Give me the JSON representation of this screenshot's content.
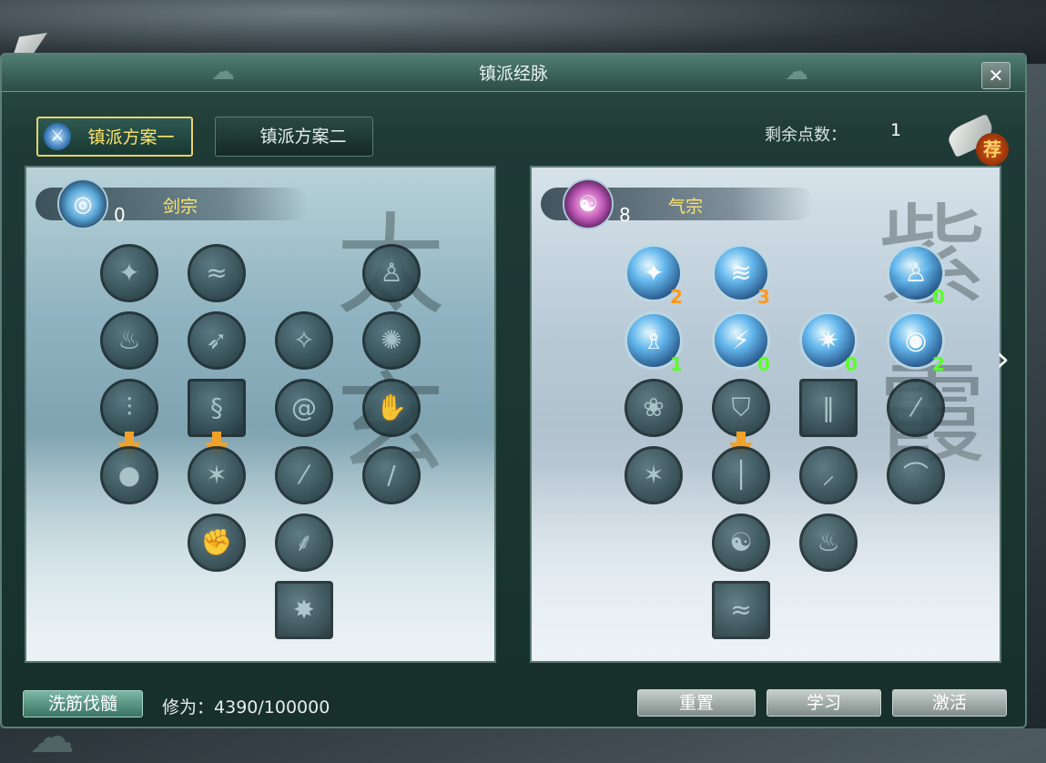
{
  "window": {
    "title": "镇派经脉",
    "close_label": "✕"
  },
  "tabs": [
    {
      "label": "镇派方案一",
      "active": true
    },
    {
      "label": "镇派方案二",
      "active": false
    }
  ],
  "points": {
    "label": "剩余点数：",
    "value": "1"
  },
  "recommend": {
    "badge": "荐"
  },
  "schools": [
    {
      "name": "剑宗",
      "count": "0",
      "deco_text": "太玄",
      "skills": [
        {
          "icon": "meditation-icon",
          "level": ""
        },
        {
          "icon": "sword-swirl-icon",
          "level": ""
        },
        {
          "icon": "warrior-icon",
          "level": ""
        },
        {
          "icon": "flame-icon",
          "level": ""
        },
        {
          "icon": "dash-icon",
          "level": ""
        },
        {
          "icon": "leap-icon",
          "level": ""
        },
        {
          "icon": "blade-spin-icon",
          "level": ""
        },
        {
          "icon": "waterfall-icon",
          "level": ""
        },
        {
          "icon": "serpent-icon",
          "level": ""
        },
        {
          "icon": "vortex-icon",
          "level": ""
        },
        {
          "icon": "palm-icon",
          "level": ""
        },
        {
          "icon": "orb-icon",
          "level": ""
        },
        {
          "icon": "burst-icon",
          "level": ""
        },
        {
          "icon": "rain-icon",
          "level": ""
        },
        {
          "icon": "slash-icon",
          "level": ""
        },
        {
          "icon": "fist-icon",
          "level": ""
        },
        {
          "icon": "claw-icon",
          "level": ""
        },
        {
          "icon": "star-burst-icon",
          "level": ""
        }
      ]
    },
    {
      "name": "气宗",
      "count": "8",
      "deco_text": "紫霞",
      "skills": [
        {
          "icon": "aura-figure-icon",
          "level": "2",
          "color": "orange"
        },
        {
          "icon": "wind-slash-icon",
          "level": "3",
          "color": "orange"
        },
        {
          "icon": "guardian-icon",
          "level": "0",
          "color": "green"
        },
        {
          "icon": "qi-monk-icon",
          "level": "1",
          "color": "green"
        },
        {
          "icon": "lightning-icon",
          "level": "0",
          "color": "green"
        },
        {
          "icon": "spark-icon",
          "level": "0",
          "color": "green"
        },
        {
          "icon": "eye-orb-icon",
          "level": "2",
          "color": "green"
        },
        {
          "icon": "lotus-icon",
          "level": ""
        },
        {
          "icon": "shield-icon",
          "level": ""
        },
        {
          "icon": "pillar-icon",
          "level": ""
        },
        {
          "icon": "stream-icon",
          "level": ""
        },
        {
          "icon": "star-icon",
          "level": ""
        },
        {
          "icon": "light-beam-icon",
          "level": ""
        },
        {
          "icon": "feather-icon",
          "level": ""
        },
        {
          "icon": "fan-icon",
          "level": ""
        },
        {
          "icon": "yin-yang-icon",
          "level": ""
        },
        {
          "icon": "ghost-icon",
          "level": ""
        },
        {
          "icon": "wave-icon",
          "level": ""
        }
      ]
    }
  ],
  "footer": {
    "wash_label": "洗筋伐髓",
    "cultivation_label": "修为：",
    "cultivation_value": "4390/100000",
    "reset_label": "重置",
    "learn_label": "学习",
    "activate_label": "激活"
  },
  "next_label": "›"
}
